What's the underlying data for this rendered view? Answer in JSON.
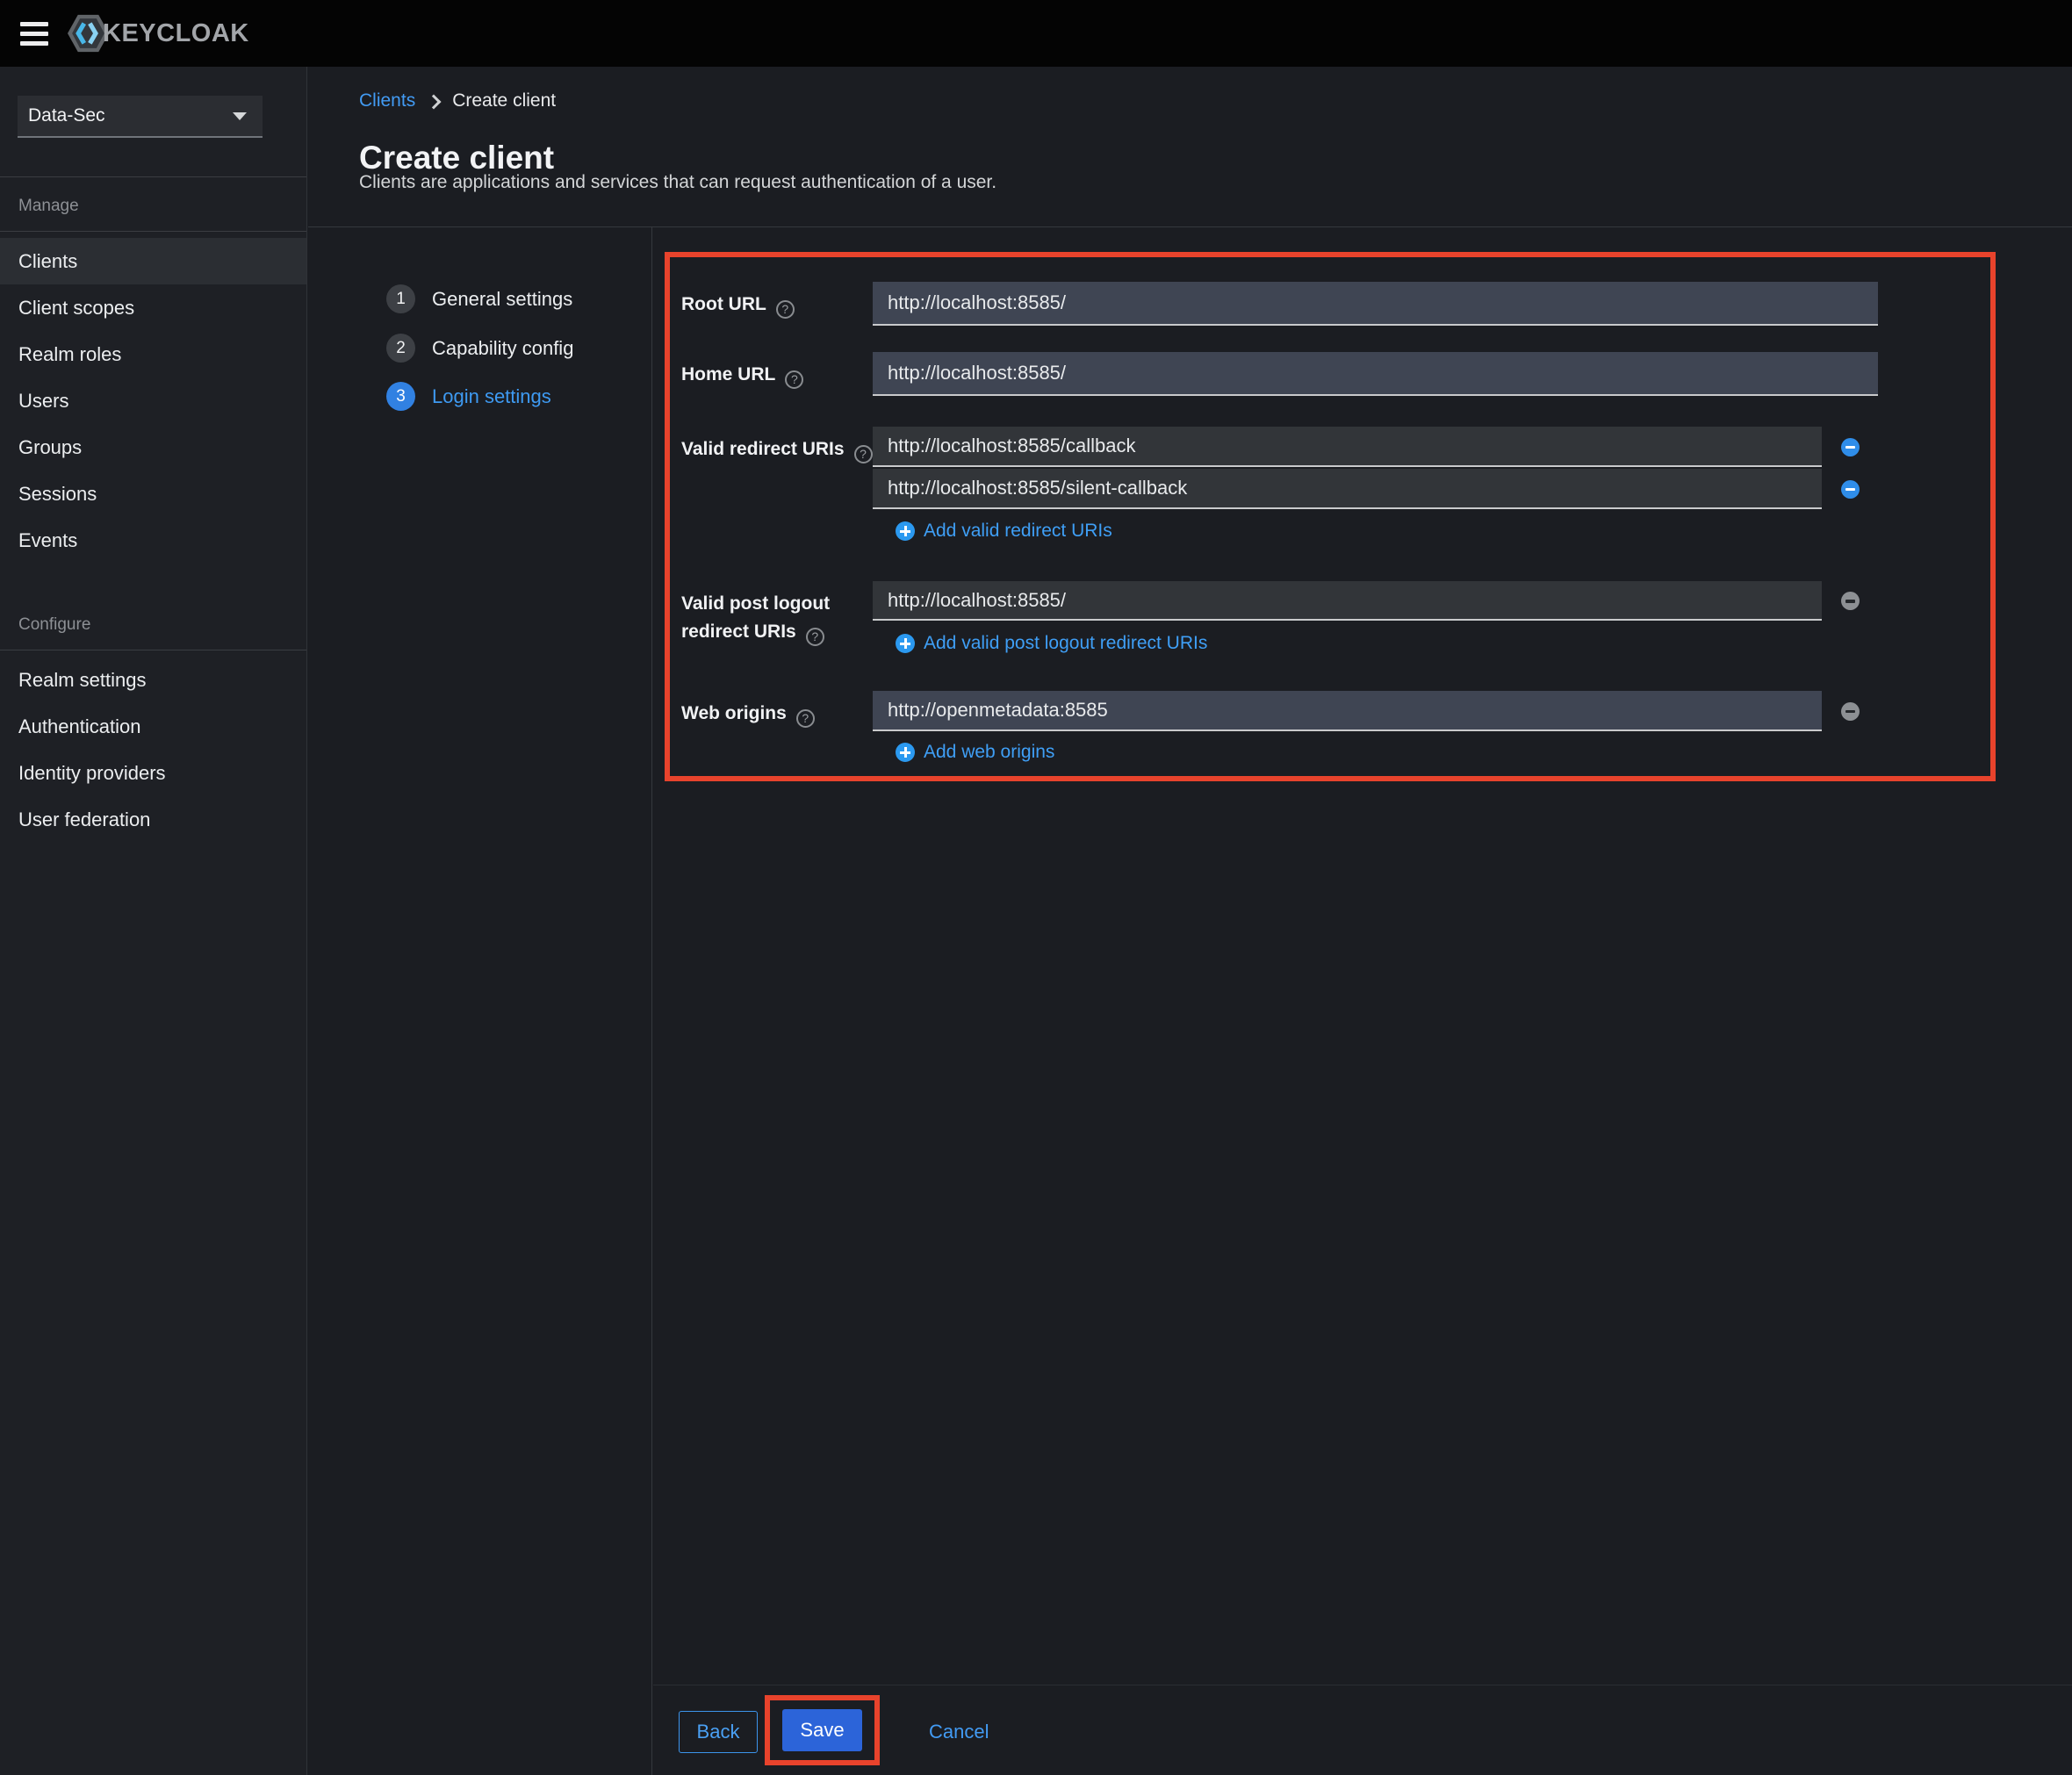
{
  "masthead": {
    "brand": "KEYCLOAK"
  },
  "sidebar": {
    "realm": "Data-Sec",
    "sections": [
      {
        "label": "Manage",
        "items": [
          "Clients",
          "Client scopes",
          "Realm roles",
          "Users",
          "Groups",
          "Sessions",
          "Events"
        ],
        "selected_item": "Clients"
      },
      {
        "label": "Configure",
        "items": [
          "Realm settings",
          "Authentication",
          "Identity providers",
          "User federation"
        ]
      }
    ]
  },
  "breadcrumb": {
    "parent": "Clients",
    "current": "Create client"
  },
  "header": {
    "title": "Create client",
    "subtitle": "Clients are applications and services that can request authentication of a user."
  },
  "wizard": {
    "steps": [
      {
        "num": "1",
        "label": "General settings"
      },
      {
        "num": "2",
        "label": "Capability config"
      },
      {
        "num": "3",
        "label": "Login settings"
      }
    ],
    "active_step": "Login settings"
  },
  "form": {
    "root_url": {
      "label": "Root URL",
      "value": "http://localhost:8585/"
    },
    "home_url": {
      "label": "Home URL",
      "value": "http://localhost:8585/"
    },
    "redirect_uris": {
      "label": "Valid redirect URIs",
      "values": [
        "http://localhost:8585/callback",
        "http://localhost:8585/silent-callback"
      ],
      "add_label": "Add valid redirect URIs"
    },
    "post_logout": {
      "label": "Valid post logout redirect URIs",
      "value": "http://localhost:8585/",
      "add_label": "Add valid post logout redirect URIs"
    },
    "web_origins": {
      "label": "Web origins",
      "value": "http://openmetadata:8585",
      "add_label": "Add web origins"
    }
  },
  "footer": {
    "back": "Back",
    "save": "Save",
    "cancel": "Cancel"
  },
  "colors": {
    "link_blue": "#3f9ff6",
    "primary_button_blue": "#2c64d9",
    "active_step_blue": "#3181e2",
    "highlight_red": "#e8432c",
    "input_light_bg": "#3f4553",
    "input_dark_bg": "#323539",
    "masthead_bg": "#040404"
  },
  "icons": {
    "hamburger": "menu",
    "caret_down": "▾",
    "chevron_right": "›",
    "help": "?",
    "plus_circle": "+",
    "minus_circle": "−"
  }
}
